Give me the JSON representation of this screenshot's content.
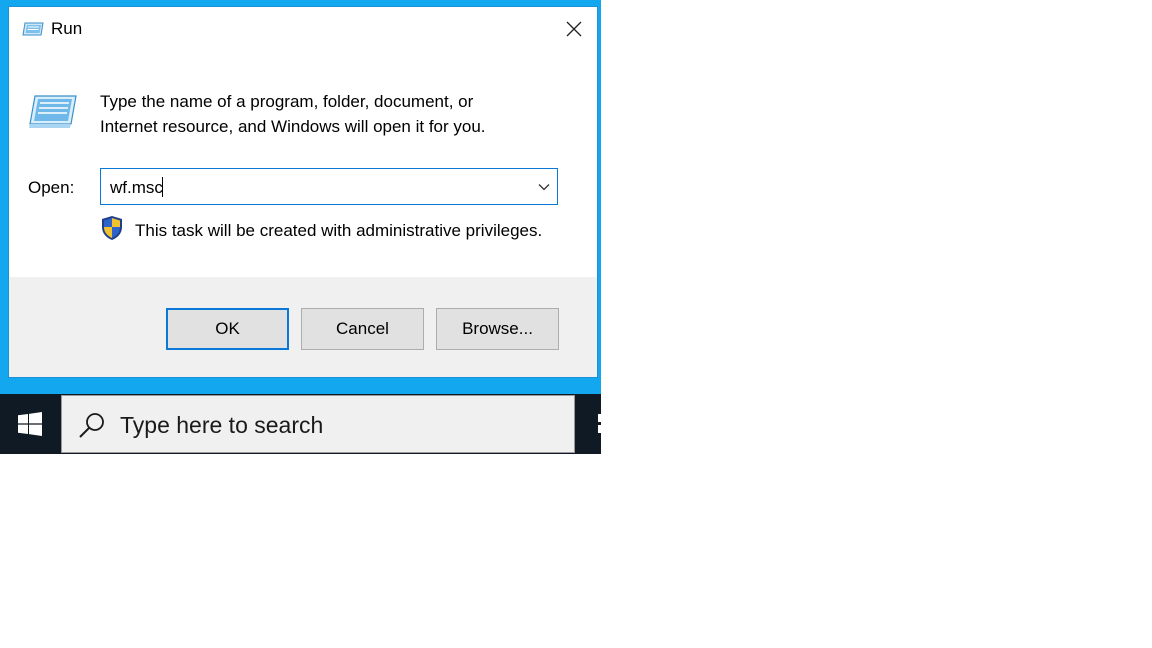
{
  "window": {
    "title": "Run",
    "title_icon": "run-icon",
    "close_icon": "close-icon"
  },
  "content": {
    "description_line1": "Type the name of a program, folder, document, or",
    "description_line2": "Internet resource, and Windows will open it for you.",
    "open_label": "Open:",
    "open_value": "wf.msc",
    "admin_notice": "This task will be created with administrative privileges."
  },
  "buttons": {
    "ok": "OK",
    "cancel": "Cancel",
    "browse": "Browse..."
  },
  "taskbar": {
    "search_placeholder": "Type here to search",
    "start_icon": "windows-logo-icon",
    "search_icon": "search-icon"
  },
  "colors": {
    "desktop": "#12a7ee",
    "accent": "#0a78d7",
    "taskbar": "#101a24",
    "footer": "#f0f0f0",
    "button": "#e1e1e1"
  }
}
